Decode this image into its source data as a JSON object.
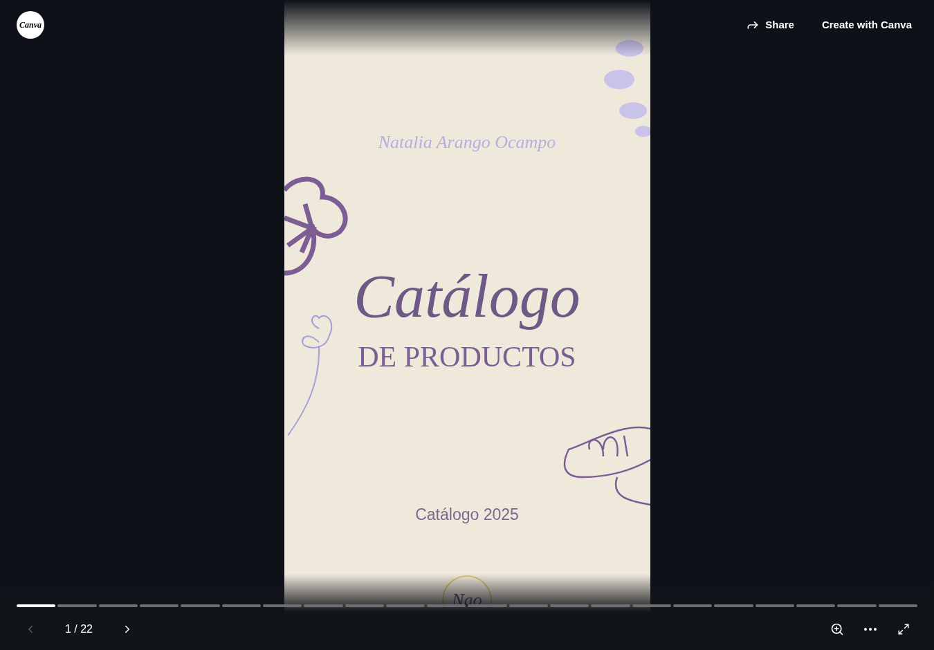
{
  "logo": {
    "text": "Canva"
  },
  "header": {
    "share": "Share",
    "create": "Create with Canva"
  },
  "slide": {
    "author": "Natalia Arango Ocampo",
    "title": "Catálogo",
    "subtitle": "DE PRODUCTOS",
    "year_label": "Catálogo 2025",
    "badge": "Nao"
  },
  "progress": [
    {
      "selected": true
    },
    {
      "selected": false
    },
    {
      "selected": false
    },
    {
      "selected": false
    },
    {
      "selected": false
    },
    {
      "selected": false
    },
    {
      "selected": false
    },
    {
      "selected": false
    },
    {
      "selected": false
    },
    {
      "selected": false
    },
    {
      "selected": false
    },
    {
      "selected": false
    },
    {
      "selected": false
    },
    {
      "selected": false
    },
    {
      "selected": false
    },
    {
      "selected": false
    },
    {
      "selected": false
    },
    {
      "selected": false
    },
    {
      "selected": false
    },
    {
      "selected": false
    },
    {
      "selected": false
    },
    {
      "selected": false
    }
  ],
  "pager": {
    "previous_disabled": true,
    "next_disabled": false,
    "page": "1 / 22"
  }
}
